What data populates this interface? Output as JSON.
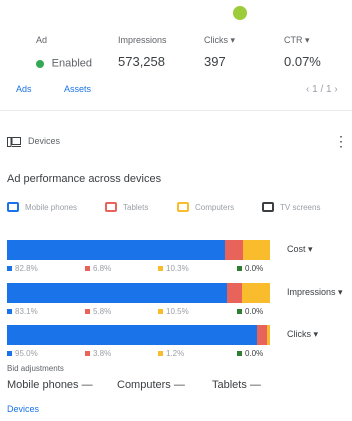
{
  "summary": {
    "title": "",
    "headers": {
      "ad": "Ad",
      "impressions": "Impressions",
      "clicks": "Clicks ▾",
      "ctr": "CTR ▾"
    },
    "row": {
      "status": "Enabled",
      "impressions": "573,258",
      "clicks": "397",
      "ctr": "0.07%"
    },
    "tabs": [
      "Ads",
      "Assets"
    ],
    "pager": "‹  1 / 1  ›"
  },
  "card": {
    "title": "Devices",
    "subtitle": "Ad performance across devices",
    "legend": [
      "Mobile phones",
      "Tablets",
      "Computers",
      "TV screens"
    ],
    "colors": {
      "mobile": "#1a73e8",
      "tablet": "#e8635a",
      "computer": "#f9bc2c",
      "tv": "#2e7d32"
    },
    "metrics": [
      {
        "label": "Cost ▾",
        "values": [
          "82.8%",
          "6.8%",
          "10.3%",
          "0.0%"
        ]
      },
      {
        "label": "Impressions ▾",
        "values": [
          "83.1%",
          "5.8%",
          "10.5%",
          "0.0%"
        ]
      },
      {
        "label": "Clicks ▾",
        "values": [
          "95.0%",
          "3.8%",
          "1.2%",
          "0.0%"
        ]
      }
    ],
    "bid_label": "Bid adjustments",
    "bid_adjustments": [
      "Mobile phones  —",
      "Computers  —",
      "Tablets  —"
    ],
    "footer_link": "Devices"
  }
}
